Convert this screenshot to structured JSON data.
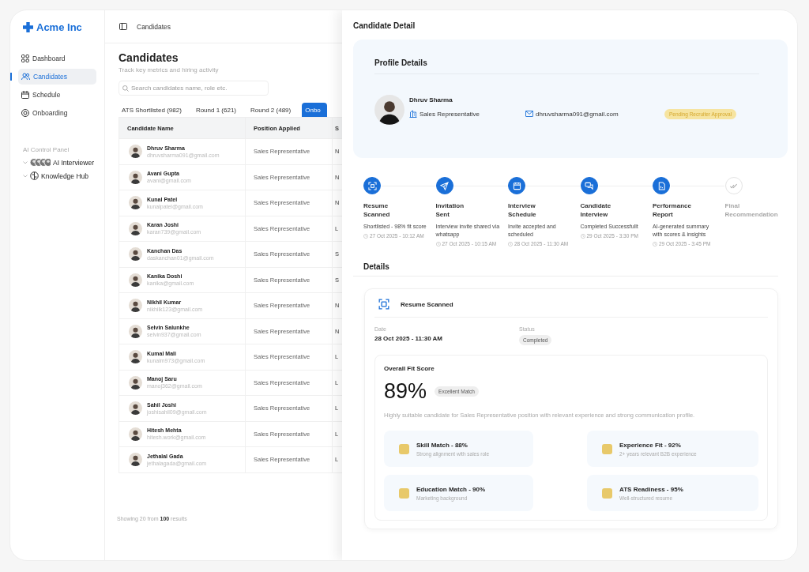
{
  "brand": {
    "name": "Acme Inc"
  },
  "sidebar": {
    "items": [
      {
        "label": "Dashboard",
        "kind": "grid",
        "selected": false
      },
      {
        "label": "Candidates",
        "kind": "people",
        "selected": true
      },
      {
        "label": "Schedule",
        "kind": "calendar",
        "selected": false
      },
      {
        "label": "Onboarding",
        "kind": "target",
        "selected": false
      }
    ],
    "section_title": "AI Control Panel",
    "groups": [
      {
        "label": "AI Interviewer",
        "kind": "avatars"
      },
      {
        "label": "Knowledge Hub",
        "kind": "brain"
      }
    ]
  },
  "header": {
    "breadcrumb": "Candidates"
  },
  "page": {
    "title": "Candidates",
    "subtitle": "Track key metrics and hiring activity"
  },
  "search": {
    "placeholder": "Search candidates name, role etc."
  },
  "tabs": [
    {
      "label": "ATS Shortlisted (982)",
      "selected": false
    },
    {
      "label": "Round 1 (621)",
      "selected": false
    },
    {
      "label": "Round 2 (489)",
      "selected": false
    },
    {
      "label": "Onbo",
      "selected": true
    }
  ],
  "table": {
    "columns": [
      "Candidate Name",
      "Position Applied",
      "S"
    ],
    "rows": [
      {
        "name": "Dhruv Sharma",
        "email": "dhruvsharma091@gmail.com",
        "position": "Sales Representative",
        "column_3": "N"
      },
      {
        "name": "Avani Gupta",
        "email": "avani@gmail.com",
        "position": "Sales Representative",
        "column_3": "N"
      },
      {
        "name": "Kunal Patel",
        "email": "kunalpatel@gmail.com",
        "position": "Sales Representative",
        "column_3": "N"
      },
      {
        "name": "Karan Joshi",
        "email": "karan739@gmail.com",
        "position": "Sales Representative",
        "column_3": "L"
      },
      {
        "name": "Kanchan Das",
        "email": "daskanchan01@gmail.com",
        "position": "Sales Representative",
        "column_3": "S"
      },
      {
        "name": "Kanika Doshi",
        "email": "kanika@gmail.com",
        "position": "Sales Representative",
        "column_3": "S"
      },
      {
        "name": "Nikhil Kumar",
        "email": "nikhilk123@gmail.com",
        "position": "Sales Representative",
        "column_3": "N"
      },
      {
        "name": "Selvin Salunkhe",
        "email": "selvin937@gmail.com",
        "position": "Sales Representative",
        "column_3": "N"
      },
      {
        "name": "Kumal Mali",
        "email": "kunalm973@gmail.com",
        "position": "Sales Representative",
        "column_3": "L"
      },
      {
        "name": "Manoj Saru",
        "email": "manoj362@gmail.com",
        "position": "Sales Representative",
        "column_3": "L"
      },
      {
        "name": "Sahil Joshi",
        "email": "joshisahil09@gmail.com",
        "position": "Sales Representative",
        "column_3": "L"
      },
      {
        "name": "Hitesh Mehta",
        "email": "hitesh.work@gmail.com",
        "position": "Sales Representative",
        "column_3": "L"
      },
      {
        "name": "Jethalal Gada",
        "email": "jethalagada@gmail.com",
        "position": "Sales Representative",
        "column_3": "L"
      }
    ]
  },
  "footer": "Showing 20 from **100** results",
  "drawer": {
    "title": "Candidate Detail",
    "profile": {
      "heading": "Profile Details",
      "name": "Dhruv Sharma",
      "role": "Sales Representative",
      "email": "dhruvsharma091@gmail.com",
      "status": "Pending Recruiter Approval"
    },
    "steps": [
      {
        "kind": "scan",
        "title": "Resume Scanned",
        "description": "Shortlisted - 98% fit score",
        "time": "27 Oct 2025 - 10:12 AM",
        "done": true
      },
      {
        "kind": "send",
        "title": "Invitation Sent",
        "description": "Interview invite shared via whatsapp",
        "time": "27 Oct 2025 - 10:15 AM",
        "done": true
      },
      {
        "kind": "calendar",
        "title": "Interview Schedule",
        "description": "Invite accepted and scheduled",
        "time": "28 Oct 2025 - 11:30 AM",
        "done": true
      },
      {
        "kind": "chat",
        "title": "Candidate Interview",
        "description": "Completed Successfullt",
        "time": "29 Oct 2025 - 3:30 PM",
        "done": true
      },
      {
        "kind": "report",
        "title": "Performance Report",
        "description": "AI-generated summary with scores & insights",
        "time": "29 Oct 2025 - 3:45 PM",
        "done": true
      },
      {
        "kind": "check",
        "title": "Final Recommendation",
        "done": false
      }
    ],
    "details": {
      "heading": "Details",
      "card_title": "Resume Scanned",
      "date_label": "Date",
      "date": "28 Oct 2025 - 11:30 AM",
      "status_label": "Status",
      "status": "Completed",
      "fit": {
        "title": "Overall Fit Score",
        "score": "89%",
        "badge": "Excellent Match",
        "summary": "Highly suitable candidate for Sales Representative position with relevant experience and strong communication profile.",
        "metrics": [
          {
            "title": "Skill Match - 88%",
            "note": "Strong alignment with sales role"
          },
          {
            "title": "Experience Fit - 92%",
            "note": "2+ years relevant B2B experience"
          },
          {
            "title": "Education Match - 90%",
            "note": "Marketing background"
          },
          {
            "title": "ATS Readiness - 95%",
            "note": "Well-structured resume"
          }
        ]
      }
    }
  }
}
